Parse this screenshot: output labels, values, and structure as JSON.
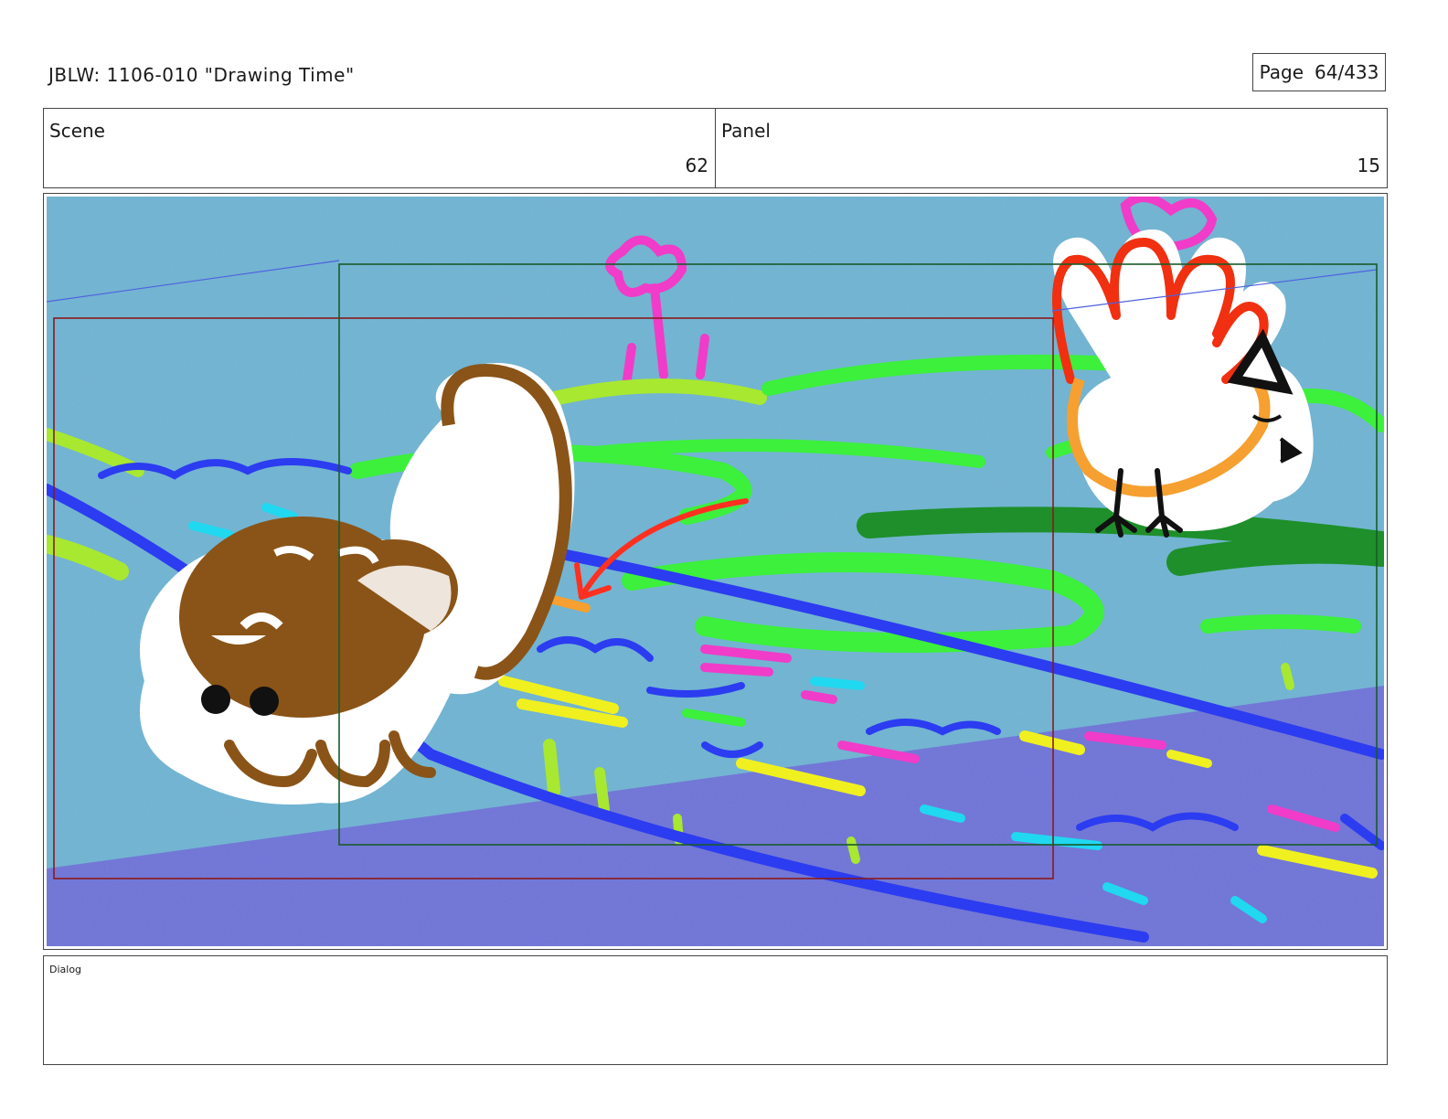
{
  "header": {
    "title": "JBLW: 1106-010 \"Drawing Time\"",
    "page_label": "Page",
    "page_value": "64/433"
  },
  "scene": {
    "label": "Scene",
    "value": "62"
  },
  "panel": {
    "label": "Panel",
    "value": "15"
  },
  "dialog": {
    "label": "Dialog",
    "text": ""
  },
  "artwork": {
    "description_colors": {
      "sky_water": "#6fb4d3",
      "ground_purple": "#6f74d8",
      "grass_green": "#3cf03c",
      "dark_green": "#1e8f2a",
      "lime": "#a8e830",
      "blue_lines": "#2c3cf0",
      "pink": "#f03cc8",
      "yellow": "#f0f020",
      "brown_creature": "#8a5418",
      "bird_orange": "#f5a030",
      "bird_red": "#f03010",
      "arrow_red": "#ff3020",
      "camera_frame_red": "#8a1a1a",
      "camera_frame_green": "#1a5a2a"
    }
  }
}
